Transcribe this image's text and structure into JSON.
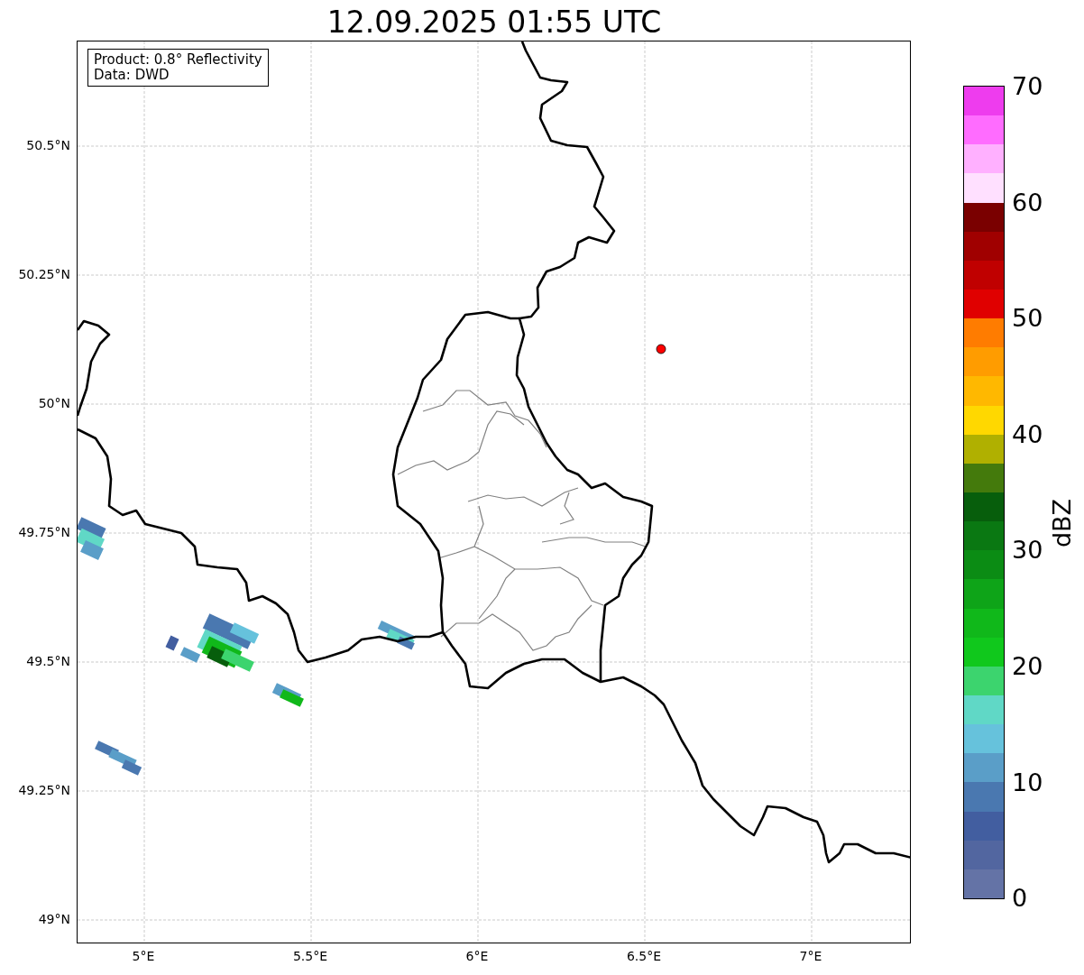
{
  "title": "12.09.2025 01:55 UTC",
  "info_box": [
    "Product: 0.8° Reflectivity",
    "Data: DWD"
  ],
  "y_ticks": [
    "50.5°N",
    "50.25°N",
    "50°N",
    "49.75°N",
    "49.5°N",
    "49.25°N",
    "49°N"
  ],
  "x_ticks": [
    "5°E",
    "5.5°E",
    "6°E",
    "6.5°E",
    "7°E"
  ],
  "colorbar": {
    "label": "dBZ",
    "ticks": [
      "70",
      "60",
      "50",
      "40",
      "30",
      "20",
      "10",
      "0"
    ],
    "bins": [
      {
        "color": "#ee3cee"
      },
      {
        "color": "#ff6cff"
      },
      {
        "color": "#ffb0ff"
      },
      {
        "color": "#ffe0ff"
      },
      {
        "color": "#7a0000"
      },
      {
        "color": "#a00000"
      },
      {
        "color": "#c00000"
      },
      {
        "color": "#e00000"
      },
      {
        "color": "#ff7c00"
      },
      {
        "color": "#ff9c00"
      },
      {
        "color": "#ffb800"
      },
      {
        "color": "#ffd800"
      },
      {
        "color": "#b0b000"
      },
      {
        "color": "#447a0c"
      },
      {
        "color": "#075e0c"
      },
      {
        "color": "#0a7812"
      },
      {
        "color": "#0b8c14"
      },
      {
        "color": "#0ea418"
      },
      {
        "color": "#10b81a"
      },
      {
        "color": "#10c81c"
      },
      {
        "color": "#3cd46e"
      },
      {
        "color": "#60d8c6"
      },
      {
        "color": "#66c2dc"
      },
      {
        "color": "#5a9ec8"
      },
      {
        "color": "#4a78b0"
      },
      {
        "color": "#425ea0"
      },
      {
        "color": "#5266a0"
      },
      {
        "color": "#6473a6"
      }
    ]
  }
}
